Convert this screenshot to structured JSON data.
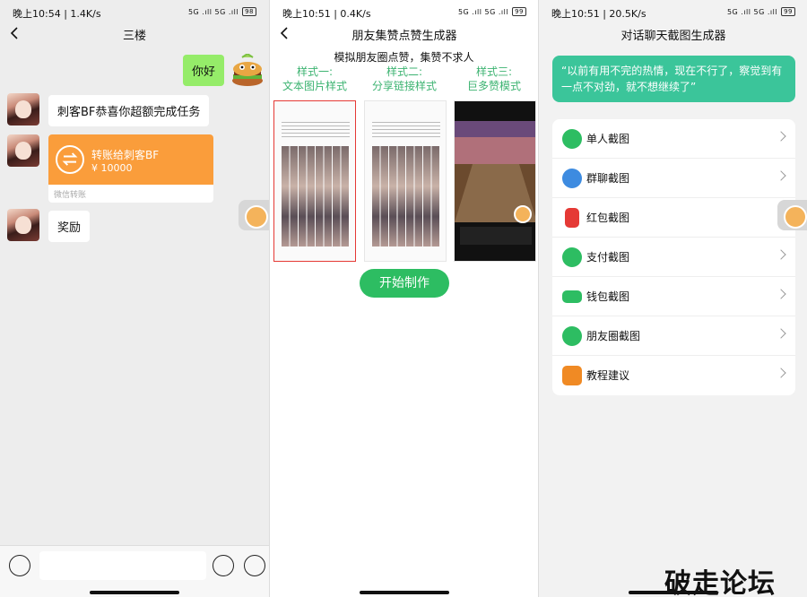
{
  "panel1": {
    "status": {
      "time": "晚上10:54",
      "speed": "1.4K/s",
      "signal": "5G .ıll 5G .ıll",
      "battery": "98"
    },
    "title": "三楼",
    "messages": {
      "mine": "你好",
      "congrats": "刺客BF恭喜你超额完成任务",
      "reward": "奖励"
    },
    "transfer": {
      "title": "转账给刺客BF",
      "amount": "¥ 10000",
      "footer": "微信转账"
    }
  },
  "panel2": {
    "status": {
      "time": "晚上10:51",
      "speed": "0.4K/s",
      "signal": "5G .ıll 5G .ıll",
      "battery": "99"
    },
    "title": "朋友集赞点赞生成器",
    "subtitle": "模拟朋友圈点赞，集赞不求人",
    "styles": [
      {
        "line1": "样式一:",
        "line2": "文本图片样式"
      },
      {
        "line1": "样式二:",
        "line2": "分享链接样式"
      },
      {
        "line1": "样式三:",
        "line2": "巨多赞模式"
      }
    ],
    "start_button": "开始制作"
  },
  "panel3": {
    "status": {
      "time": "晚上10:51",
      "speed": "20.5K/s",
      "signal": "5G .ıll 5G .ıll",
      "battery": "99"
    },
    "title": "对话聊天截图生成器",
    "quote": "“以前有用不完的热情，现在不行了，察觉到有一点不对劲，就不想继续了”",
    "menu": [
      {
        "label": "单人截图",
        "icon": "wechat-icon",
        "color": "#2dbd62"
      },
      {
        "label": "群聊截图",
        "icon": "group-icon",
        "color": "#3d8be0"
      },
      {
        "label": "红包截图",
        "icon": "red-packet-icon",
        "color": "#e53935"
      },
      {
        "label": "支付截图",
        "icon": "payment-check-icon",
        "color": "#2dbd62"
      },
      {
        "label": "钱包截图",
        "icon": "wallet-icon",
        "color": "#2dbd62"
      },
      {
        "label": "朋友圈截图",
        "icon": "thumb-up-icon",
        "color": "#2dbd62"
      },
      {
        "label": "教程建议",
        "icon": "help-icon",
        "color": "#f08a24"
      }
    ],
    "watermark": "破走论坛"
  }
}
